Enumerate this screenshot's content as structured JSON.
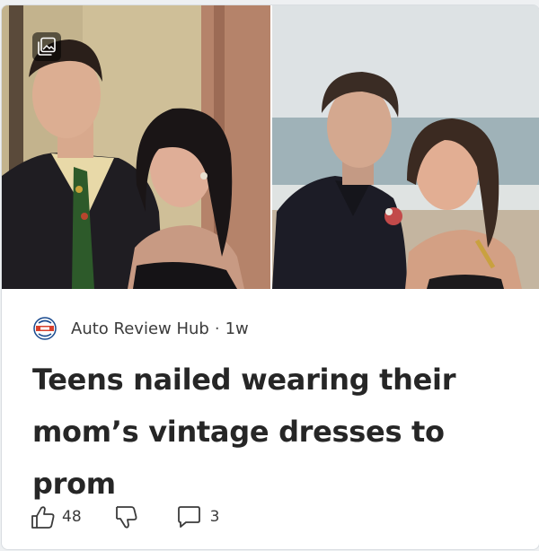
{
  "card": {
    "source_name": "Auto Review Hub",
    "separator": "·",
    "age": "1w",
    "headline": "Teens nailed wearing their mom’s vintage dresses to prom",
    "source_logo_icon": "globe-badge-icon",
    "gallery_icon": "image-gallery-icon"
  },
  "actions": {
    "like_count": "48",
    "comment_count": "3",
    "like_icon": "thumbs-up-icon",
    "dislike_icon": "thumbs-down-icon",
    "comment_icon": "speech-bubble-icon"
  },
  "colors": {
    "card_background": "#ffffff",
    "headline_text": "#262626",
    "meta_text": "#3b3b3b",
    "page_background": "#eef0f2"
  }
}
